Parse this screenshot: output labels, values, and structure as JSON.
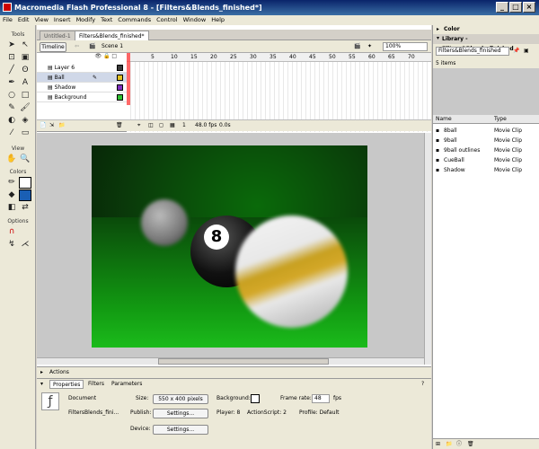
{
  "window": {
    "title": "Macromedia Flash Professional 8 - [Filters&Blends_finished*]"
  },
  "menu": [
    "File",
    "Edit",
    "View",
    "Insert",
    "Modify",
    "Text",
    "Commands",
    "Control",
    "Window",
    "Help"
  ],
  "tools": {
    "label_tools": "Tools",
    "label_view": "View",
    "label_colors": "Colors",
    "label_options": "Options"
  },
  "doc_tabs": [
    "Untitled-1",
    "Filters&Blends_finished*"
  ],
  "timeline": {
    "button": "Timeline",
    "scene": "Scene 1",
    "zoom": "100%",
    "frame_numbers": [
      "5",
      "10",
      "15",
      "20",
      "25",
      "30",
      "35",
      "40",
      "45",
      "50",
      "55",
      "60",
      "65",
      "70"
    ],
    "frame": "1",
    "fps": "48.0 fps",
    "time": "0.0s"
  },
  "layers": [
    {
      "name": "Layer 6",
      "color": "#3a3a3a"
    },
    {
      "name": "Ball",
      "color": "#e0c020"
    },
    {
      "name": "Shadow",
      "color": "#8030c0"
    },
    {
      "name": "Background",
      "color": "#30c030"
    }
  ],
  "right_panel": {
    "color_label": "Color",
    "library_title": "Library - Filters&Blends_finished",
    "library_select": "Filters&Blends_finished",
    "items_count": "5 items",
    "col_name": "Name",
    "col_type": "Type",
    "items": [
      {
        "name": "8ball",
        "type": "Movie Clip"
      },
      {
        "name": "9ball",
        "type": "Movie Clip"
      },
      {
        "name": "9ball outlines",
        "type": "Movie Clip"
      },
      {
        "name": "CueBall",
        "type": "Movie Clip"
      },
      {
        "name": "Shadow",
        "type": "Movie Clip"
      }
    ]
  },
  "actions_label": "Actions",
  "properties": {
    "tabs": [
      "Properties",
      "Filters",
      "Parameters"
    ],
    "doc_label": "Document",
    "doc_name": "FiltersBlends_fini...",
    "size_label": "Size:",
    "size_value": "550 x 400 pixels",
    "background_label": "Background:",
    "framerate_label": "Frame rate:",
    "framerate_value": "48",
    "fps_label": "fps",
    "publish_label": "Publish:",
    "settings_label": "Settings...",
    "player_label": "Player: 8",
    "actionscript_label": "ActionScript: 2",
    "profile_label": "Profile: Default",
    "device_label": "Device:",
    "device_settings": "Settings..."
  },
  "eight_ball_number": "8"
}
